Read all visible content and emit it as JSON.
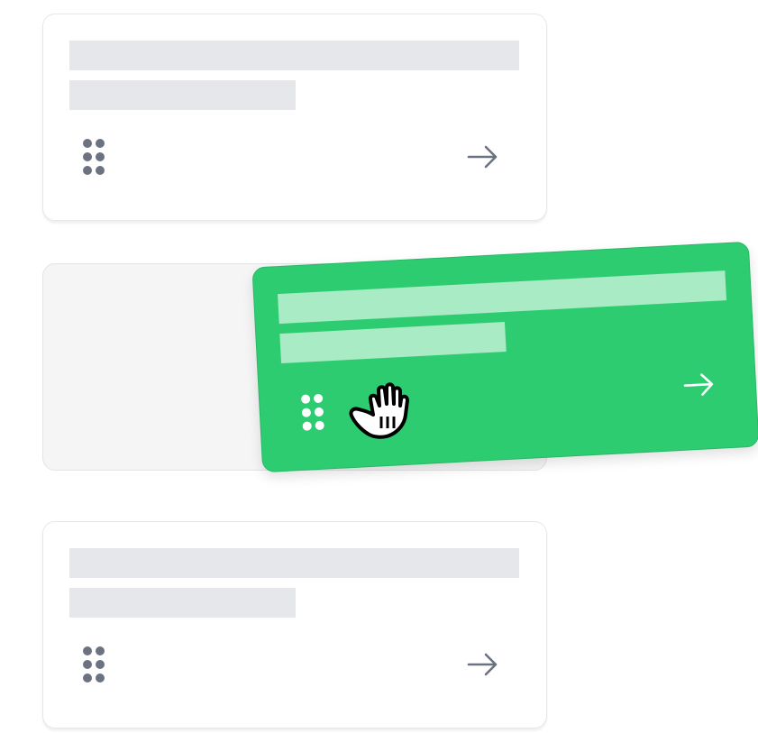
{
  "cards": [
    {
      "id": "card-1",
      "state": "idle"
    },
    {
      "id": "card-2",
      "state": "dragging"
    },
    {
      "id": "card-3",
      "state": "idle"
    }
  ],
  "icons": {
    "grip": "drag-handle-icon",
    "arrow": "arrow-right-icon",
    "cursor": "grab-hand-cursor-icon"
  },
  "colors": {
    "card_border": "#e5e7eb",
    "skeleton": "#e5e7eb",
    "icon": "#6b7280",
    "drag_card": "#2ecc71",
    "drag_skeleton": "#a8ebc4",
    "drop_slot": "#f5f5f6"
  }
}
